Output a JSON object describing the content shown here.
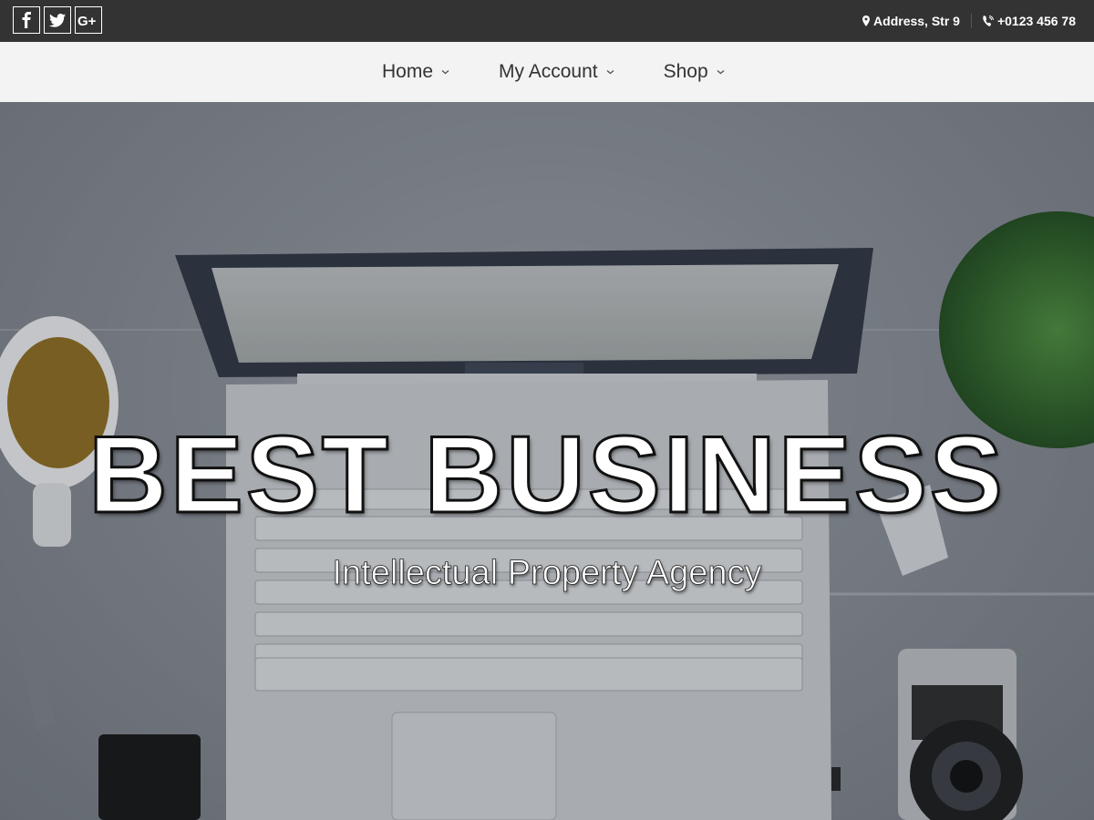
{
  "topbar": {
    "social": [
      {
        "icon": "facebook-icon",
        "label": "f"
      },
      {
        "icon": "twitter-icon",
        "label": "twitter"
      },
      {
        "icon": "google-plus-icon",
        "label": "G+"
      }
    ],
    "address": "Address, Str 9",
    "phone": "+0123 456 78"
  },
  "nav": {
    "items": [
      {
        "label": "Home"
      },
      {
        "label": "My Account"
      },
      {
        "label": "Shop"
      }
    ]
  },
  "hero": {
    "title": "BEST BUSINESS",
    "subtitle": "Intellectual Property Agency"
  },
  "colors": {
    "topbar_bg": "#333333",
    "nav_bg": "#f3f3f3",
    "nav_text": "#333333"
  }
}
